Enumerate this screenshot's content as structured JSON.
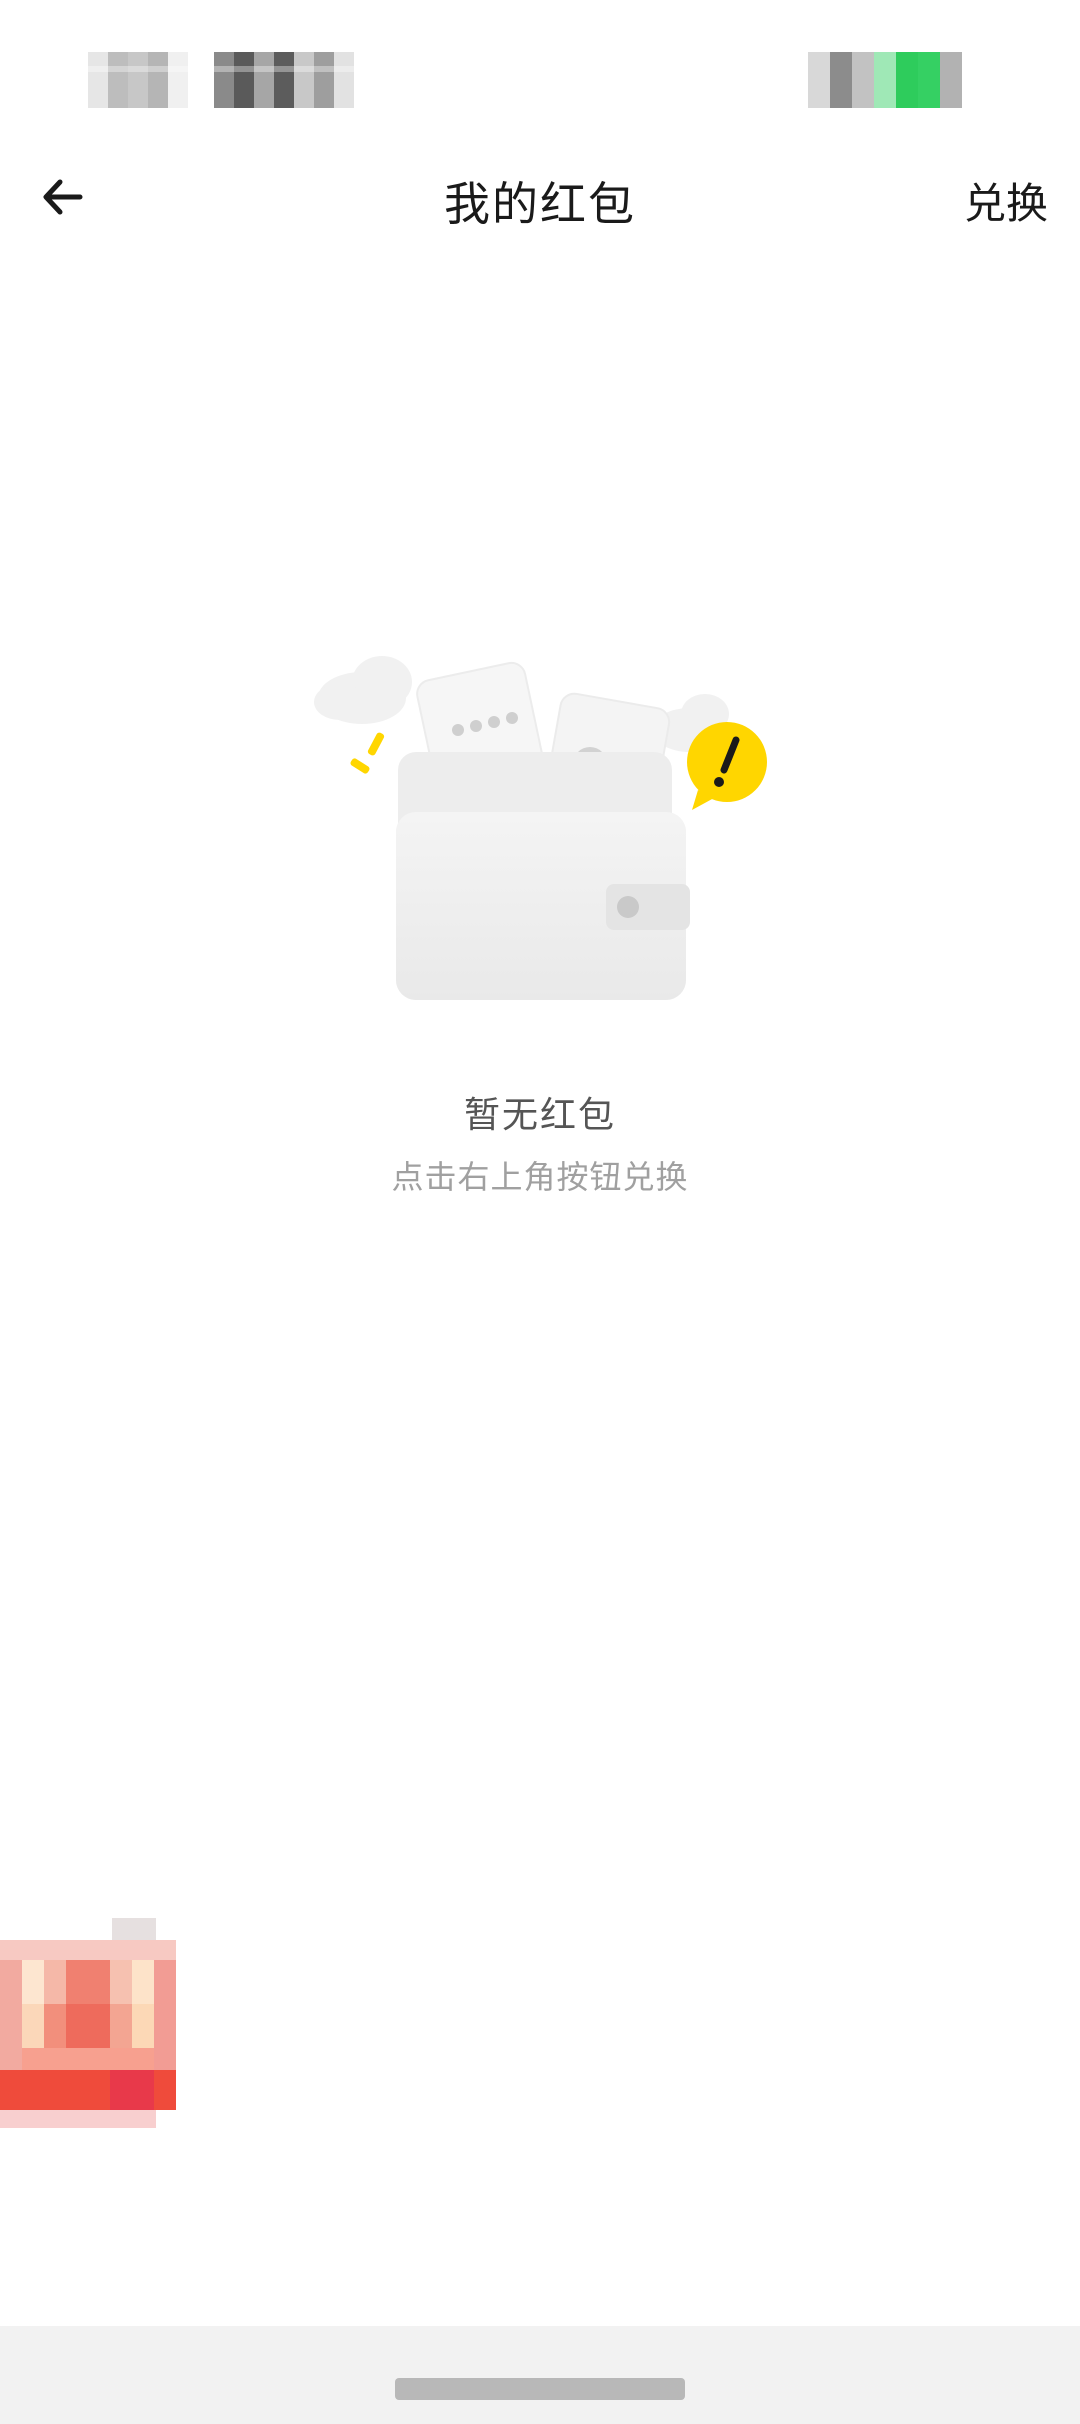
{
  "header": {
    "title": "我的红包",
    "action_label": "兑换"
  },
  "empty_state": {
    "title": "暂无红包",
    "subtitle": "点击右上角按钮兑换"
  },
  "icons": {
    "back": "arrow-left-icon",
    "illustration": "empty-wallet-icon",
    "badge": "red-packet-icon"
  },
  "colors": {
    "accent_yellow": "#FFD600",
    "status_green": "#2ecc5c",
    "badge_red": "#ef4b3b"
  }
}
